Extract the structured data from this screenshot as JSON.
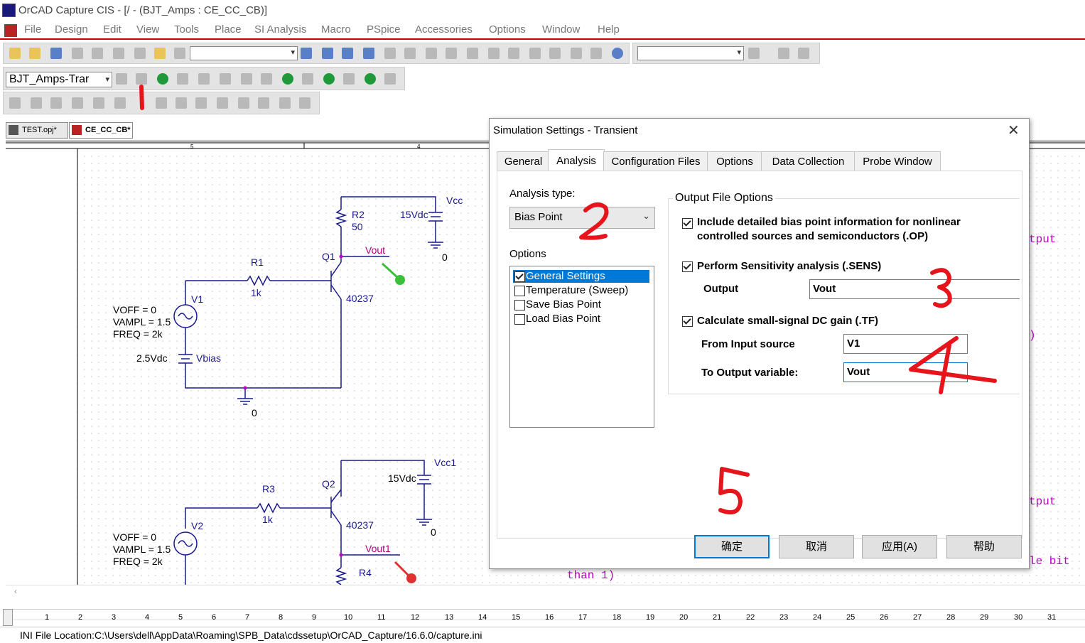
{
  "window": {
    "title": "OrCAD Capture CIS - [/ - (BJT_Amps : CE_CC_CB)]"
  },
  "menu": [
    "File",
    "Design",
    "Edit",
    "View",
    "Tools",
    "Place",
    "SI Analysis",
    "Macro",
    "PSpice",
    "Accessories",
    "Options",
    "Window",
    "Help"
  ],
  "toolbar": {
    "profile_combo": "BJT_Amps-Trar",
    "part_combo": "",
    "search_combo": "",
    "icons": [
      "new-icon",
      "open-icon",
      "save-icon",
      "print-icon",
      "cut-icon",
      "copy-icon",
      "paste-icon",
      "undo-icon",
      "redo-icon",
      "zoom-in-icon",
      "zoom-out-icon",
      "zoom-area-icon",
      "zoom-all-icon",
      "binoculars-icon",
      "help-icon",
      "run-icon",
      "voltage-marker-icon",
      "current-marker-icon",
      "power-marker-icon"
    ]
  },
  "doc_tabs": [
    {
      "label": "TEST.opj*"
    },
    {
      "label": "CE_CC_CB*"
    }
  ],
  "schematic": {
    "labels": {
      "vcc": "Vcc",
      "v15a": "15Vdc",
      "r2": "R2",
      "r2v": "50",
      "q1": "Q1",
      "vout": "Vout",
      "r1": "R1",
      "r1v": "1k",
      "q1part": "40237",
      "v1": "V1",
      "voff1": "VOFF = 0",
      "vampl1": "VAMPL = 1.5",
      "freq1": "FREQ = 2k",
      "v25": "2.5Vdc",
      "vbias": "Vbias",
      "gnd1": "0",
      "gnd2": "0",
      "vcc1": "Vcc1",
      "v15b": "15Vdc",
      "q2": "Q2",
      "r3": "R3",
      "r3v": "1k",
      "q2part": "40237",
      "v2": "V2",
      "voff2": "VOFF = 0",
      "vampl2": "VAMPL = 1.5",
      "freq2": "FREQ = 2k",
      "vout1": "Vout1",
      "r4": "R4",
      "gnd3": "0",
      "border5": "5",
      "border4": "4"
    },
    "code_text": [
      "tput",
      "tput",
      "le bit",
      "than 1)",
      ")"
    ]
  },
  "dialog": {
    "title": "Simulation Settings - Transient",
    "tabs": [
      "General",
      "Analysis",
      "Configuration Files",
      "Options",
      "Data Collection",
      "Probe Window"
    ],
    "analysis_type_label": "Analysis type:",
    "analysis_type_value": "Bias Point",
    "options_label": "Options",
    "options": [
      {
        "label": "General Settings",
        "checked": true,
        "selected": true
      },
      {
        "label": "Temperature (Sweep)",
        "checked": false
      },
      {
        "label": "Save Bias Point",
        "checked": false
      },
      {
        "label": "Load Bias Point",
        "checked": false
      }
    ],
    "output_group_title": "Output File Options",
    "op_check_line1": "Include detailed bias point information for nonlinear",
    "op_check_line2": "controlled sources and semiconductors (.OP)",
    "sens_check": "Perform Sensitivity analysis (.SENS)",
    "output_label": "Output",
    "output_value": "Vout",
    "tf_check": "Calculate small-signal DC gain (.TF)",
    "from_input_label": "From Input source",
    "from_input_value": "V1",
    "to_output_label": "To Output variable:",
    "to_output_value": "Vout",
    "buttons": {
      "ok": "确定",
      "cancel": "取消",
      "apply": "应用(A)",
      "help": "帮助"
    }
  },
  "ruler": [
    "1",
    "2",
    "3",
    "4",
    "5",
    "6",
    "7",
    "8",
    "9",
    "10",
    "11",
    "12",
    "13",
    "14",
    "15",
    "16",
    "17",
    "18",
    "19",
    "20",
    "21",
    "22",
    "23",
    "24",
    "25",
    "26",
    "27",
    "28",
    "29",
    "30",
    "31"
  ],
  "status": {
    "ini_path": "INI File Location:C:\\Users\\dell\\AppData\\Roaming\\SPB_Data\\cdssetup\\OrCAD_Capture/16.6.0/capture.ini"
  },
  "annotations": [
    "1",
    "2",
    "3",
    "4",
    "5"
  ],
  "colors": {
    "wire": "#1a1a8c",
    "net": "#b0007a",
    "annotation": "#e8141c",
    "selection": "#0078d7"
  }
}
